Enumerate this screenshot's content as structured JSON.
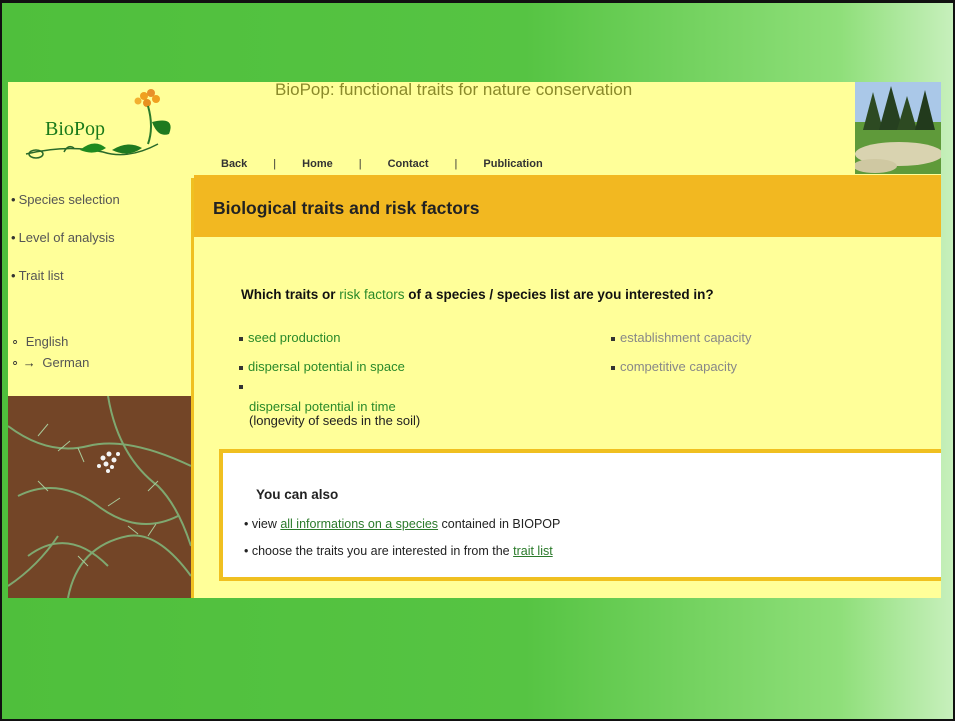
{
  "site": {
    "logo_text": "BioPop",
    "title": "BioPop: functional traits for nature conservation"
  },
  "nav": {
    "items": [
      "Back",
      "Home",
      "Contact",
      "Publication"
    ],
    "separator": "|"
  },
  "sidebar": {
    "items": [
      "Species selection",
      "Level of analysis",
      "Trait list"
    ],
    "languages": [
      {
        "label": "English",
        "marker": "∘"
      },
      {
        "label": "German",
        "marker": "∘ →"
      }
    ],
    "bullet": "•"
  },
  "main": {
    "heading": "Biological traits and risk factors",
    "question": {
      "part1": "Which traits or ",
      "risk_link": "risk factors",
      "part2": " of a species / species list are you interested in?"
    },
    "traits_left": [
      "seed production",
      "dispersal potential in space",
      "dispersal potential in time"
    ],
    "traits_right": [
      "establishment capacity",
      "competitive capacity"
    ],
    "longevity_note": "(longevity of seeds in the soil)",
    "also": {
      "title": "You can also",
      "line1_pre": "• view ",
      "line1_link": "all informations on a species",
      "line1_post": " contained in BIOPOP",
      "line2_pre": "• choose the traits you are interested in from the ",
      "line2_link": "trait list"
    }
  },
  "colors": {
    "page_bg": "#ffff99",
    "accent_band": "#f2b821",
    "link_green": "#2a8a2a",
    "disabled_gray": "#888888"
  },
  "icons": [
    "biopop-logo-icon",
    "landscape-photo",
    "plant-photo"
  ]
}
